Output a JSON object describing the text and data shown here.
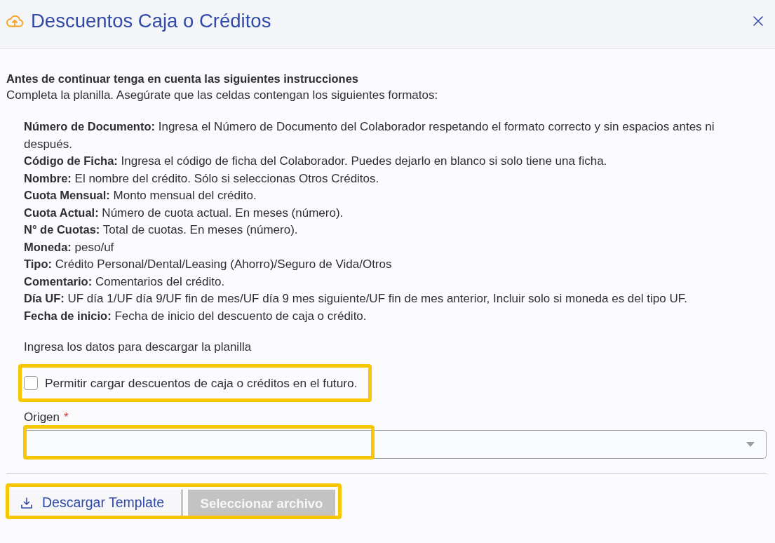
{
  "dialog": {
    "title": "Descuentos Caja o Créditos"
  },
  "instructions": {
    "heading": "Antes de continuar tenga en cuenta las siguientes instrucciones",
    "intro": "Completa la planilla. Asegúrate que las celdas contengan los siguientes formatos:",
    "fields": [
      "**Número de Documento:** Ingresa el Número de Documento del Colaborador respetando el formato correcto y sin espacios antes ni después.",
      "**Código de Ficha:** Ingresa el código de ficha del Colaborador. Puedes dejarlo en blanco si solo tiene una ficha.",
      "**Nombre:** El nombre del crédito. Sólo si seleccionas Otros Créditos.",
      "**Cuota Mensual:** Monto mensual del crédito.",
      "**Cuota Actual:** Número de cuota actual. En meses (número).",
      "**N° de Cuotas:** Total de cuotas. En meses (número).",
      "**Moneda:** peso/uf",
      "**Tipo:** Crédito Personal/Dental/Leasing (Ahorro)/Seguro de Vida/Otros",
      "**Comentario:** Comentarios del crédito.",
      "**Día UF:** UF día 1/UF día 9/UF fin de mes/UF día 9 mes siguiente/UF fin de mes anterior, Incluir solo si moneda es del tipo UF.",
      "**Fecha de inicio:** Fecha de inicio del descuento de caja o crédito."
    ],
    "prompt": "Ingresa los datos para descargar la planilla"
  },
  "form": {
    "future_checkbox": {
      "label": "Permitir cargar descuentos de caja o créditos en el futuro.",
      "checked": false,
      "highlighted": true
    },
    "origin_select": {
      "label": "Origen",
      "required_mark": "*",
      "highlighted": true
    }
  },
  "actions": {
    "highlighted": true,
    "buttons": [
      {
        "label": "Descargar Template",
        "kind": "download",
        "disabled": false
      },
      {
        "label": "Seleccionar archivo",
        "kind": "file",
        "disabled": true
      }
    ]
  }
}
